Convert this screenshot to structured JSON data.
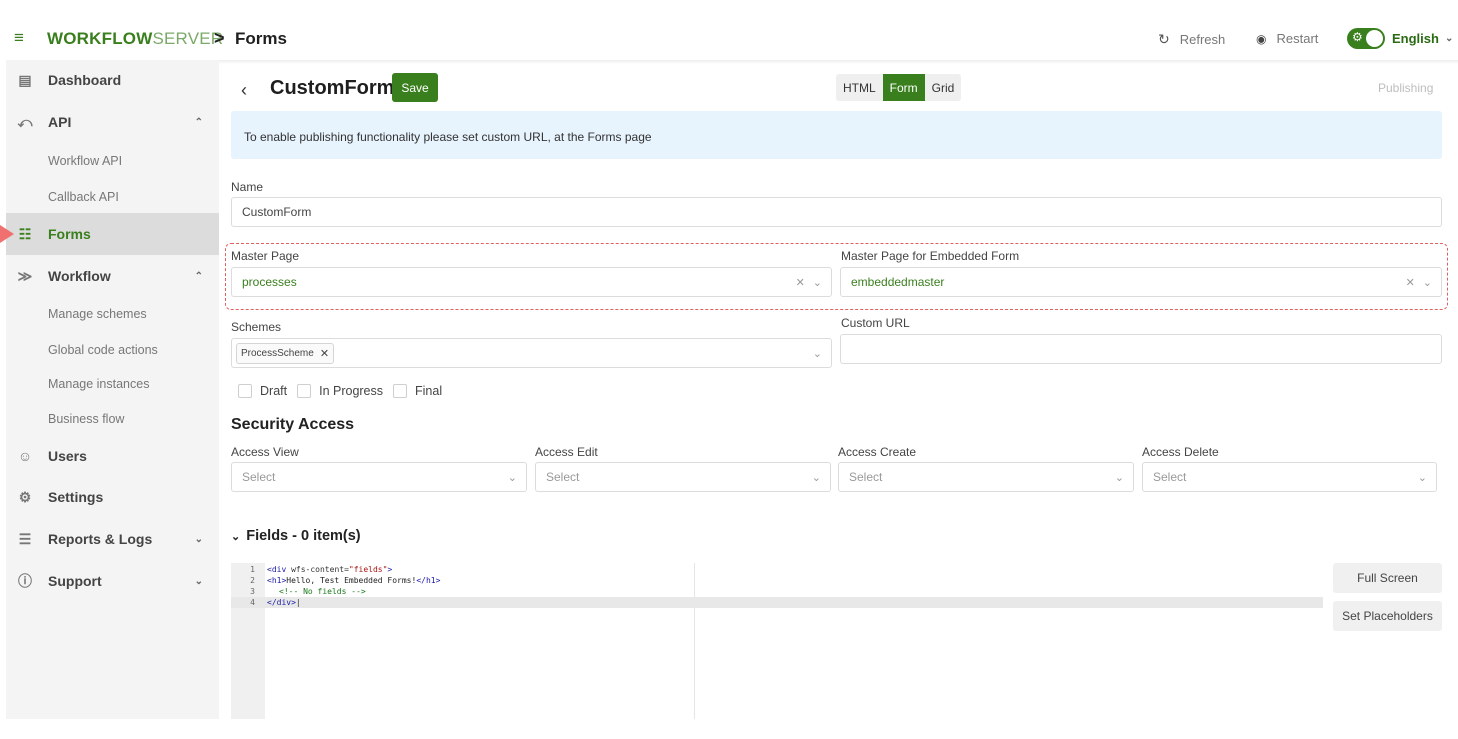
{
  "app": {
    "logo_bold": "WORKFLOW",
    "logo_light": "SERVER",
    "crumb_sep": ">",
    "page": "Forms"
  },
  "toolbar": {
    "refresh": "Refresh",
    "restart": "Restart",
    "language": "English",
    "accent": "#3a7f1e"
  },
  "sidebar": {
    "items": [
      {
        "label": "Dashboard",
        "icon": "dashboard-icon"
      },
      {
        "label": "API",
        "icon": "plug-icon"
      },
      {
        "label": "Forms",
        "icon": "form-icon"
      },
      {
        "label": "Workflow",
        "icon": "workflow-icon"
      },
      {
        "label": "Users",
        "icon": "users-icon"
      },
      {
        "label": "Settings",
        "icon": "settings-icon"
      },
      {
        "label": "Reports & Logs",
        "icon": "reports-icon"
      },
      {
        "label": "Support",
        "icon": "help-icon"
      }
    ],
    "api_sub": [
      "Workflow API",
      "Callback API"
    ],
    "workflow_sub": [
      "Manage schemes",
      "Global code actions",
      "Manage instances",
      "Business flow"
    ]
  },
  "form": {
    "title": "CustomForm",
    "save": "Save",
    "modes": [
      "HTML",
      "Form",
      "Grid"
    ],
    "active_mode": "Form",
    "publishing": "Publishing",
    "info": "To enable publishing functionality please set custom URL, at the Forms page",
    "name_label": "Name",
    "name_value": "CustomForm",
    "master_label": "Master Page",
    "master_value": "processes",
    "embedded_label": "Master Page for Embedded Form",
    "embedded_value": "embeddedmaster",
    "schemes_label": "Schemes",
    "scheme_tag": "ProcessScheme",
    "custom_url_label": "Custom URL",
    "custom_url_value": "",
    "checks": [
      "Draft",
      "In Progress",
      "Final"
    ]
  },
  "security": {
    "title": "Security Access",
    "fields": [
      {
        "label": "Access View",
        "placeholder": "Select"
      },
      {
        "label": "Access Edit",
        "placeholder": "Select"
      },
      {
        "label": "Access Create",
        "placeholder": "Select"
      },
      {
        "label": "Access Delete",
        "placeholder": "Select"
      }
    ]
  },
  "fields": {
    "title": "Fields - 0 item(s)",
    "code": {
      "l1_open": "<div ",
      "l1_attr": "wfs-content=",
      "l1_str": "\"fields\"",
      "l1_close": ">",
      "l2_open": "<h1>",
      "l2_text": "Hello, Test Embedded Forms!",
      "l2_close": "</h1>",
      "l3": "<!-- No fields -->",
      "l4": "</div>"
    },
    "full_screen": "Full Screen",
    "set_placeholders": "Set Placeholders"
  }
}
